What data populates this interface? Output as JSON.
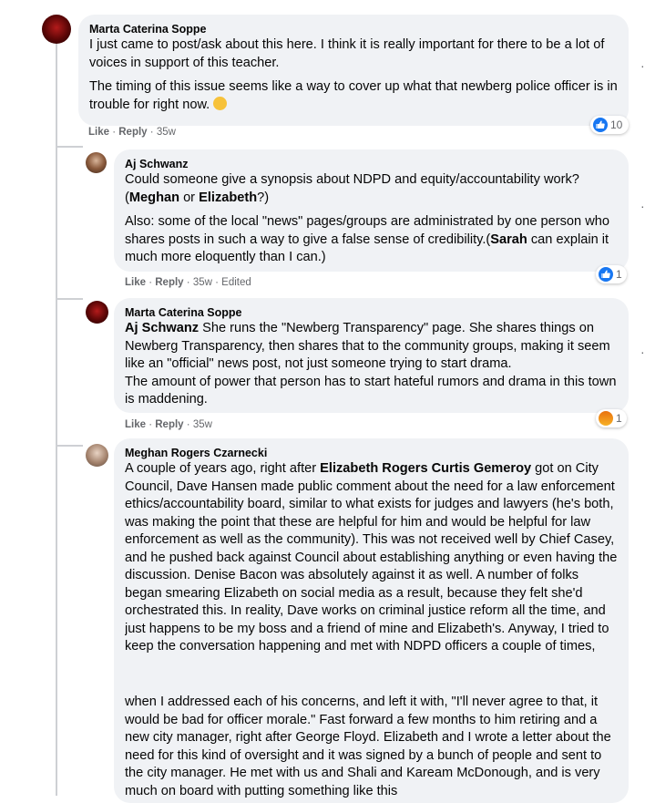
{
  "comments": [
    {
      "author": "Marta Caterina Soppe",
      "para1": "I just came to post/ask about this here. I think it is really important for there to be a lot of voices in support of this teacher.",
      "para2": "The timing of this issue seems like a way to cover up what that newberg police officer is in trouble for right now.",
      "like": "Like",
      "reply": "Reply",
      "time": "35w",
      "reaction_count": "10",
      "reaction": "like"
    },
    {
      "author": "Aj Schwanz",
      "para1_a": "Could someone give a synopsis about NDPD and equity/accountability work? (",
      "mention1": "Meghan",
      "para1_b": " or ",
      "mention2": "Elizabeth",
      "para1_c": "?)",
      "para2_a": "Also: some of the local \"news\" pages/groups are administrated by one person who shares posts in such a way to give a false sense of credibility.(",
      "mention3": "Sarah",
      "para2_b": " can explain it much more eloquently than I can.)",
      "like": "Like",
      "reply": "Reply",
      "time": "35w",
      "edited": "Edited",
      "reaction_count": "1",
      "reaction": "like"
    },
    {
      "author": "Marta Caterina Soppe",
      "mention": "Aj Schwanz",
      "text": " She runs the \"Newberg Transparency\" page. She shares things on Newberg Transparency, then shares that to the community groups, making it seem like an \"official\" news post, not just someone trying to start drama.",
      "text2": "The amount of power that person has to start hateful rumors and drama in this town is maddening.",
      "like": "Like",
      "reply": "Reply",
      "time": "35w",
      "reaction_count": "1",
      "reaction": "angry"
    },
    {
      "author": "Meghan Rogers Czarnecki",
      "text_a": "A couple of years ago, right after ",
      "mention": "Elizabeth Rogers Curtis Gemeroy",
      "text_b": " got on City Council, Dave Hansen made public comment about the need for a law enforcement ethics/accountability board, similar to what exists for judges and lawyers (he's both, was making the point that these are helpful for him and would be helpful for law enforcement as well as the community). This was not received well by Chief Casey, and he pushed back against Council about establishing anything or even having the discussion. Denise Bacon was absolutely against it as well. A number of folks began smearing Elizabeth on social media as a result, because they felt she'd orchestrated this. In reality, Dave works on criminal justice reform all the time, and just happens to be my boss and a friend of mine and Elizabeth's. Anyway, I tried to keep the conversation happening and met with NDPD officers a couple of times,",
      "text_c": "when I addressed each of his concerns, and left it with, \"I'll never agree to that, it would be bad for officer morale.\" Fast forward a few months to him retiring and a new city manager, right after George Floyd. Elizabeth and I wrote a letter about the need for this kind of oversight and it was signed by a bunch of people and sent to the city manager. He met with us and Shali and Kaream McDonough, and is very much on board with putting something like this"
    }
  ],
  "more_dots": "·"
}
